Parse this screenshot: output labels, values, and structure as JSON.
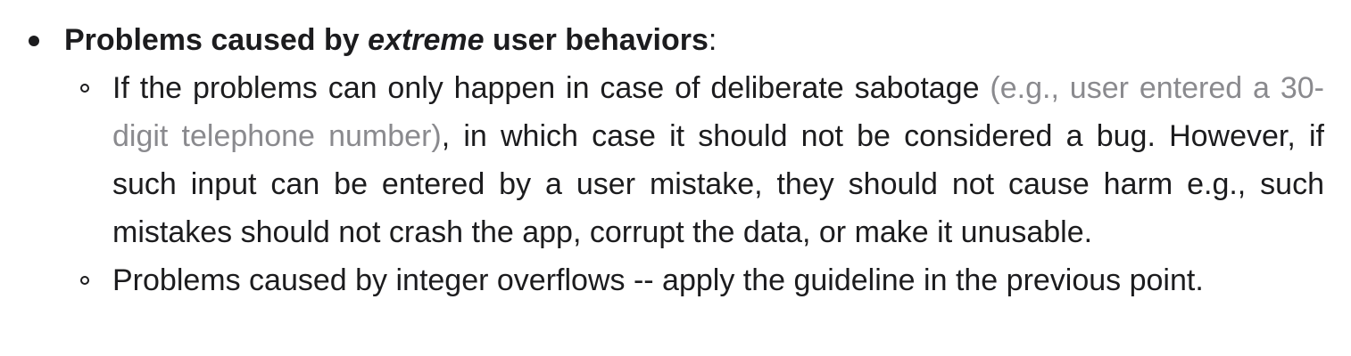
{
  "list": {
    "top_item": {
      "prefix": "Problems caused by ",
      "emphasis": "extreme",
      "suffix": " user behaviors",
      "colon": ":"
    },
    "sub_items": [
      {
        "text_before": "If the problems can only happen in case of deliberate sabotage ",
        "example": "(e.g., user entered a 30-digit telephone number)",
        "text_after": ", in which case it should not be considered a bug. However, if such input can be entered by a user mistake, they should not cause harm e.g., such mistakes should not crash the app, corrupt the data, or make it unusable."
      },
      {
        "text": "Problems caused by integer overflows -- apply the guideline in the previous point."
      }
    ]
  }
}
